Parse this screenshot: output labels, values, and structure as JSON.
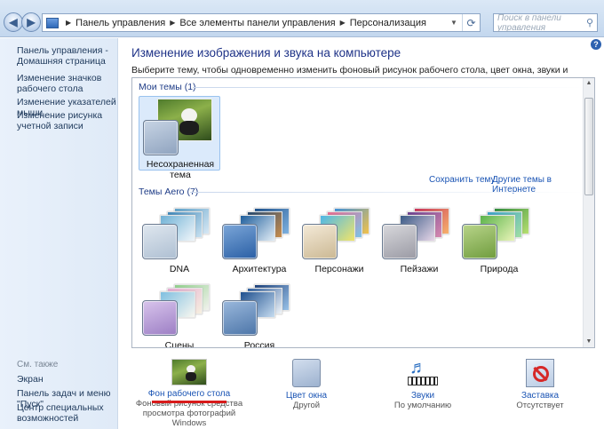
{
  "address_bar": {
    "crumbs": [
      "Панель управления",
      "Все элементы панели управления",
      "Персонализация"
    ],
    "search_placeholder": "Поиск в панели управления"
  },
  "sidebar": {
    "home": "Панель управления - Домашняя страница",
    "links": [
      "Изменение значков рабочего стола",
      "Изменение указателей мыши",
      "Изменение рисунка учетной записи"
    ],
    "see_also_heading": "См. также",
    "see_also": [
      "Экран",
      "Панель задач и меню \"Пуск\"",
      "Центр специальных возможностей"
    ]
  },
  "main": {
    "title": "Изменение изображения и звука на компьютере",
    "description": "Выберите тему, чтобы одновременно изменить фоновый рисунок рабочего стола, цвет окна, звуки и заставку.",
    "my_themes_heading": "Мои темы (1)",
    "unsaved_theme": "Несохраненная тема",
    "save_theme_link": "Сохранить тему",
    "online_themes_link": "Другие темы в Интернете",
    "aero_heading": "Темы Aero (7)",
    "aero_themes": [
      "DNA",
      "Архитектура",
      "Персонажи",
      "Пейзажи",
      "Природа",
      "Сцены",
      "Россия"
    ]
  },
  "bottom": {
    "background": {
      "title": "Фон рабочего стола",
      "sub": "Фоновый рисунок средства просмотра фотографий Windows"
    },
    "color": {
      "title": "Цвет окна",
      "sub": "Другой"
    },
    "sounds": {
      "title": "Звуки",
      "sub": "По умолчанию"
    },
    "screensaver": {
      "title": "Заставка",
      "sub": "Отсутствует"
    }
  },
  "colors": {
    "heading_blue": "#1e3287",
    "link_blue": "#1a54b4",
    "highlight": "#d81b1b"
  }
}
